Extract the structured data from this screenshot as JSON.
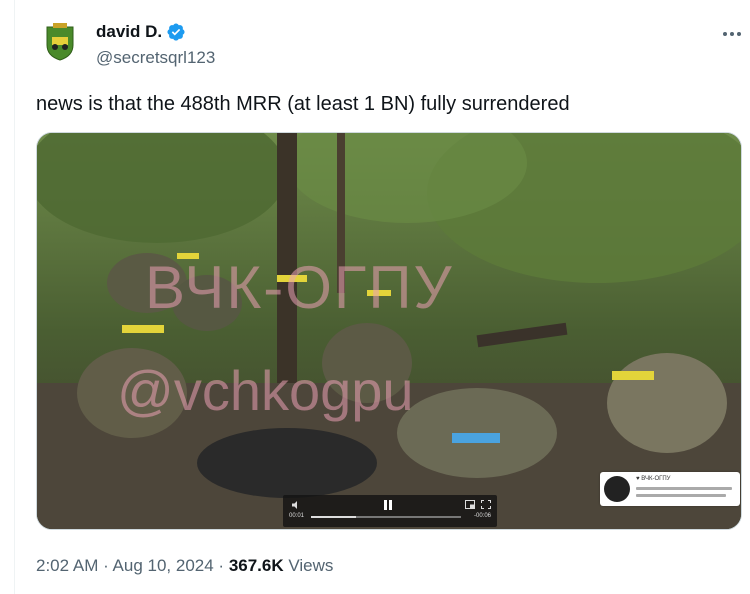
{
  "author": {
    "name": "david D.",
    "handle": "@secretsqrl123",
    "verified": true,
    "avatar_icon": "green-coat-of-arms-icon"
  },
  "tweet": {
    "text": "news is that the 488th MRR (at least 1 BN) fully surrendered"
  },
  "media": {
    "watermark_line1": "ВЧК-ОГПУ",
    "watermark_line2": "@vchkogpu",
    "player": {
      "current_time": "00:01",
      "remaining_time": "-00:06",
      "progress": 0.3
    },
    "overlay_card": {
      "name": "♥ ВЧК-ОГПУ"
    }
  },
  "meta": {
    "time": "2:02 AM",
    "sep1": " · ",
    "date": "Aug 10, 2024",
    "sep2": " · ",
    "views_count": "367.6K",
    "views_label": " Views"
  },
  "colors": {
    "text": "#0f1419",
    "secondary": "#536471",
    "verified_blue": "#1d9bf0",
    "border": "#cfd9de"
  }
}
